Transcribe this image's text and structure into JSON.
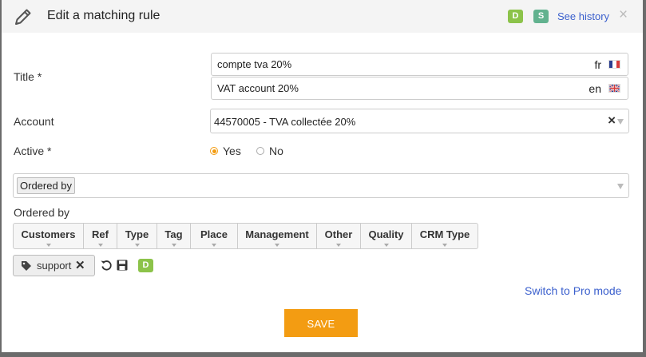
{
  "dialog": {
    "title": "Edit a matching rule",
    "badge_d": "D",
    "badge_s": "S",
    "see_history": "See history",
    "close": "×"
  },
  "form": {
    "title_label": "Title *",
    "title_fr": {
      "value": "compte tva 20%",
      "lang": "fr"
    },
    "title_en": {
      "value": "VAT account 20%",
      "lang": "en"
    },
    "account_label": "Account",
    "account_value": "44570005 - TVA collectée 20%",
    "active_label": "Active *",
    "active_yes": "Yes",
    "active_no": "No",
    "active_selected": "Yes"
  },
  "ordered_by": {
    "chip": "Ordered by",
    "section_label": "Ordered by",
    "columns": [
      "Customers",
      "Ref",
      "Type",
      "Tag",
      "Place",
      "Management",
      "Other",
      "Quality",
      "CRM Type"
    ]
  },
  "tag": {
    "label": "support",
    "remove": "✕",
    "badge": "D"
  },
  "footer": {
    "switch_pro": "Switch to Pro mode",
    "save": "SAVE"
  },
  "colors": {
    "accent": "#f39c12",
    "link": "#3a5fcd",
    "badge_d": "#8cc34a",
    "badge_s": "#62b28f",
    "header_bg": "#f4f4f4"
  },
  "icons": [
    "pencil-icon",
    "close-icon",
    "flag-fr-icon",
    "flag-uk-icon",
    "clear-icon",
    "caret-down-icon",
    "tag-icon",
    "reset-icon",
    "save-icon"
  ]
}
